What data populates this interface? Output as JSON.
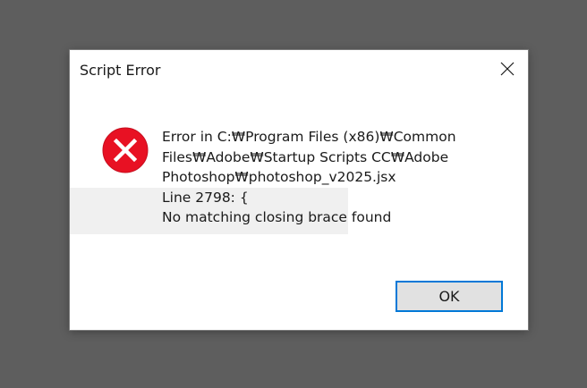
{
  "dialog": {
    "title": "Script Error",
    "icon": "error-icon",
    "message_lines": [
      "Error in C:₩Program Files (x86)₩Common",
      "Files₩Adobe₩Startup Scripts CC₩Adobe",
      "Photoshop₩photoshop_v2025.jsx",
      "Line 2798: {",
      "No matching closing brace found"
    ],
    "ok_label": "OK"
  },
  "colors": {
    "desktop_background": "#5e5e5e",
    "dialog_background": "#ffffff",
    "error_red": "#e81123",
    "button_focus_border": "#0078d7",
    "button_background": "#e1e1e1"
  }
}
